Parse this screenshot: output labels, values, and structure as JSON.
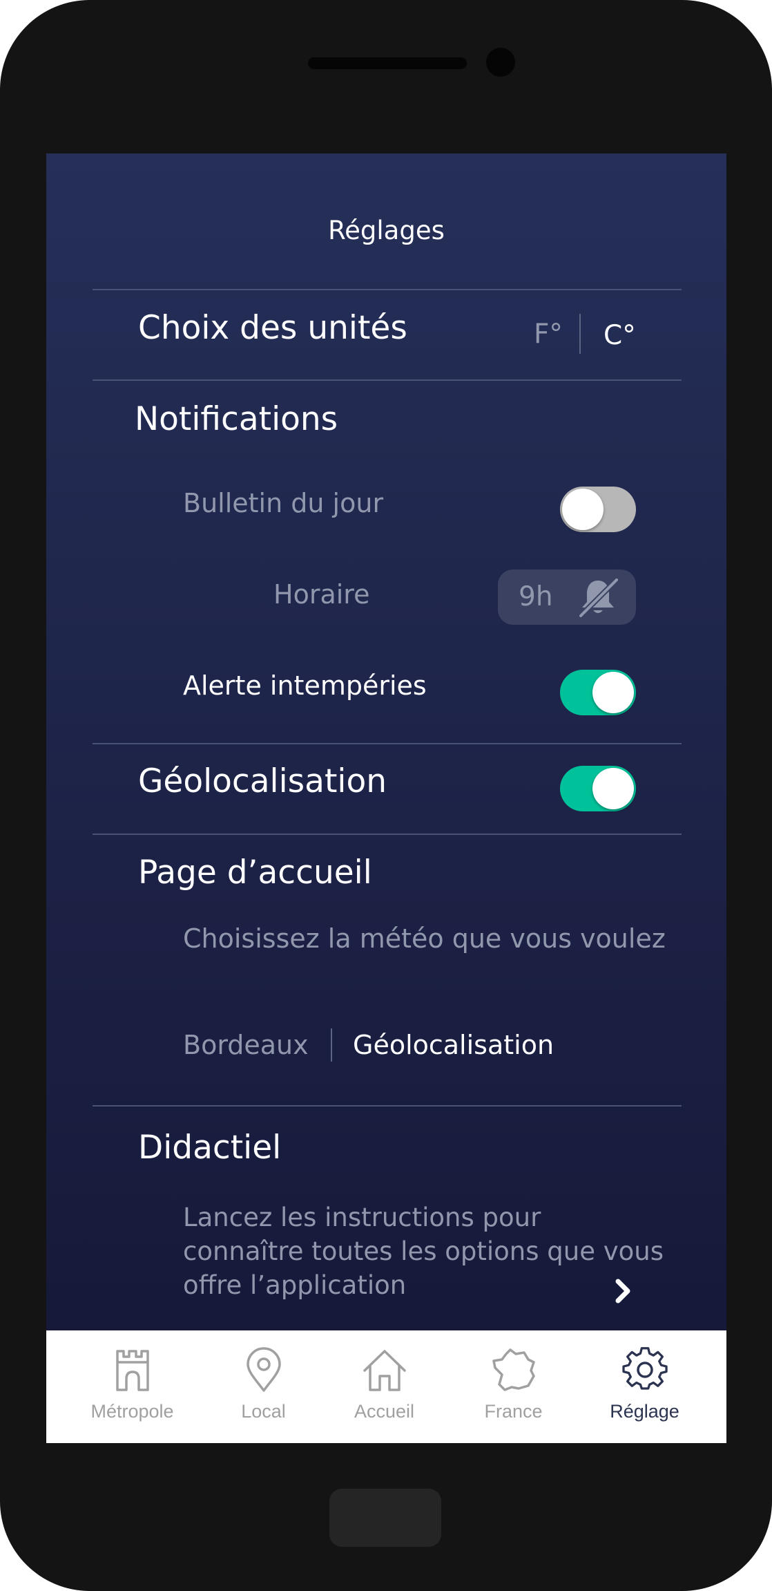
{
  "header": {
    "title": "Réglages"
  },
  "units": {
    "title": "Choix des unités",
    "option_f": "F°",
    "option_c": "C°",
    "selected": "C°"
  },
  "notifications": {
    "title": "Notifications",
    "daily_bulletin": {
      "label": "Bulletin du jour",
      "enabled": false
    },
    "schedule": {
      "label": "Horaire",
      "time": "9h"
    },
    "weather_alert": {
      "label": "Alerte intempéries",
      "enabled": true
    }
  },
  "geolocation": {
    "title": "Géolocalisation",
    "enabled": true
  },
  "home_page": {
    "title": "Page d’accueil",
    "description": "Choisissez la météo que vous voulez",
    "option_city": "Bordeaux",
    "option_geo": "Géolocalisation",
    "selected": "Géolocalisation"
  },
  "tutorial": {
    "title": "Didactiel",
    "description_lines": [
      "Lancez les instructions pour",
      "connaître toutes les options que vous",
      "offre l’application"
    ]
  },
  "nav": {
    "active": "Réglage",
    "items": [
      {
        "label": "Métropole",
        "icon": "tower-icon"
      },
      {
        "label": "Local",
        "icon": "map-pin-icon"
      },
      {
        "label": "Accueil",
        "icon": "home-icon"
      },
      {
        "label": "France",
        "icon": "france-map-icon"
      },
      {
        "label": "Réglage",
        "icon": "gear-icon"
      }
    ]
  },
  "colors": {
    "background_top": "#252f58",
    "background_bottom": "#161939",
    "toggle_on": "#00c29a",
    "toggle_off": "#b7b7b7",
    "muted_text": "#9198ad",
    "nav_active": "#2b3350",
    "nav_inactive": "#a0a0a0"
  }
}
